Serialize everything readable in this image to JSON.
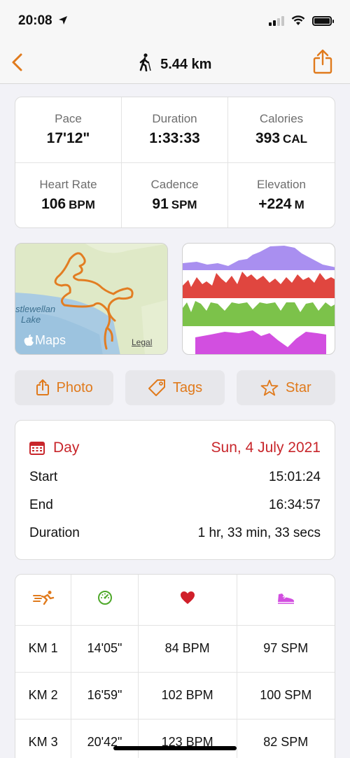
{
  "status_bar": {
    "time": "20:08"
  },
  "nav": {
    "title": "5.44 km"
  },
  "stats": [
    {
      "label": "Pace",
      "value": "17'12\"",
      "unit": ""
    },
    {
      "label": "Duration",
      "value": "1:33:33",
      "unit": ""
    },
    {
      "label": "Calories",
      "value": "393",
      "unit": "CAL"
    },
    {
      "label": "Heart Rate",
      "value": "106",
      "unit": "BPM"
    },
    {
      "label": "Cadence",
      "value": "91",
      "unit": "SPM"
    },
    {
      "label": "Elevation",
      "value": "+224",
      "unit": "M"
    }
  ],
  "map": {
    "place_line1": "stlewellan",
    "place_line2": "Lake",
    "brand": "Maps",
    "legal": "Legal"
  },
  "actions": {
    "photo": "Photo",
    "tags": "Tags",
    "star": "Star"
  },
  "day": {
    "title": "Day",
    "date": "Sun, 4 July 2021",
    "rows": [
      {
        "label": "Start",
        "value": "15:01:24"
      },
      {
        "label": "End",
        "value": "16:34:57"
      },
      {
        "label": "Duration",
        "value": "1 hr, 33 min, 33 secs"
      }
    ]
  },
  "splits": {
    "rows": [
      {
        "km": "KM 1",
        "pace": "14'05\"",
        "hr": "84 BPM",
        "cadence": "97 SPM"
      },
      {
        "km": "KM 2",
        "pace": "16'59\"",
        "hr": "102 BPM",
        "cadence": "100 SPM"
      },
      {
        "km": "KM 3",
        "pace": "20'42\"",
        "hr": "123 BPM",
        "cadence": "82 SPM"
      }
    ]
  },
  "colors": {
    "accent": "#e07a1c",
    "day_red": "#c8262b",
    "elevation": "#a98ff0",
    "heart": "#e0463f",
    "cadence_chart": "#7cc24a",
    "pace_chart": "#d24fe0"
  }
}
